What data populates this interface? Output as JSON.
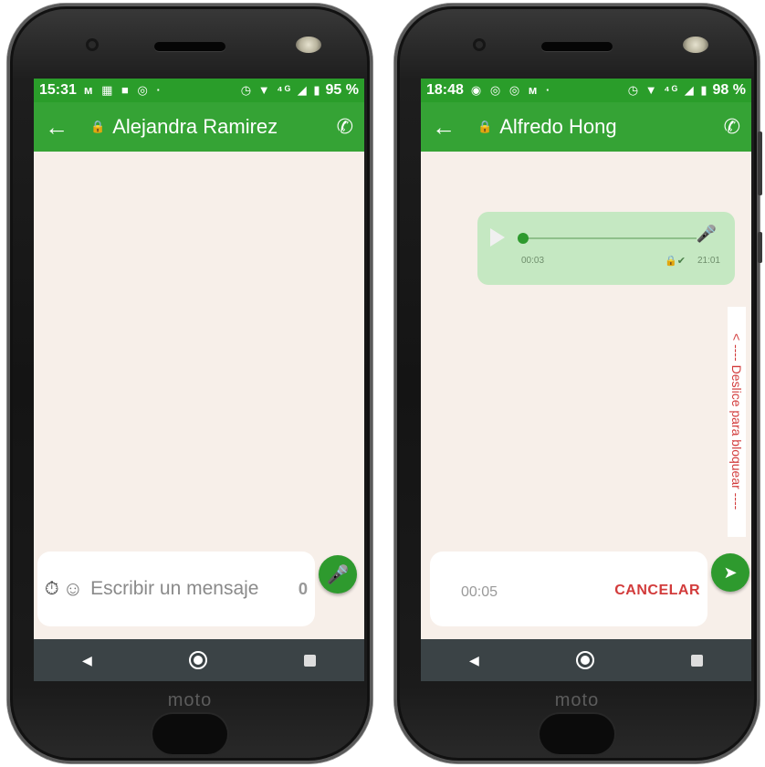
{
  "left_phone": {
    "status_time": "15:31",
    "status_icons_left": "ᴍ ▦ ■ ◎ ·",
    "status_icons_right": "◷ ▼ ⁴ᴳ ◢ ▮",
    "battery": "95 %",
    "back_glyph": "←",
    "lock_glyph": "🔒",
    "contact_name": "Alejandra Ramirez",
    "call_glyph": "✆",
    "timer_glyph": "⏱",
    "emoji_glyph": "☺",
    "placeholder": "Escribir un mensaje",
    "attach_glyph": "𝟎",
    "mic_glyph": "🎤",
    "brand": "moto"
  },
  "right_phone": {
    "status_time": "18:48",
    "status_icons_left": "◉ ◎ ◎ ᴍ ·",
    "status_icons_right": "◷ ▼ ⁴ᴳ ◢ ▮",
    "battery": "98 %",
    "back_glyph": "←",
    "lock_glyph": "🔒",
    "contact_name": "Alfredo Hong",
    "call_glyph": "✆",
    "voice_duration": "00:03",
    "voice_time": "21:01",
    "voice_status_glyph": "🔒✔",
    "voice_mic_glyph": "🎤",
    "slide_hint": "< ---- Deslice para bloquear ----",
    "recording_timer": "00:05",
    "cancel_label": "CANCELAR",
    "send_glyph": "➤",
    "brand": "moto"
  },
  "colors": {
    "status_bar": "#2a9d2a",
    "app_bar": "#35a335",
    "chat_bg": "#f7efe9",
    "bubble": "#c5e8c2",
    "accent_red": "#d23b3b",
    "fab": "#2e9a2e"
  }
}
